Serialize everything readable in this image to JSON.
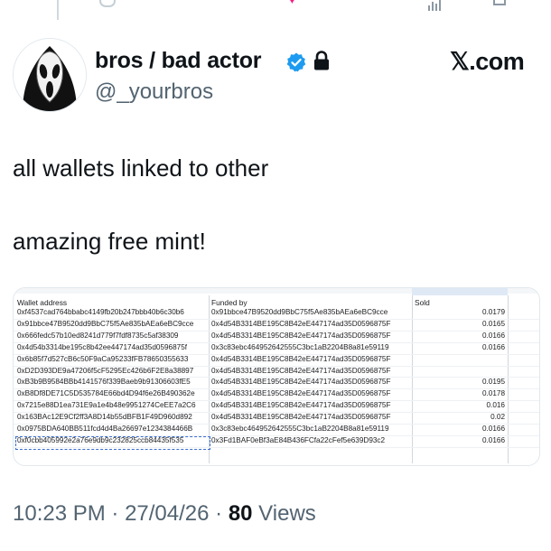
{
  "header": {
    "name": "bros / bad actor",
    "handle": "@_yourbros",
    "brand": "𝕏.com"
  },
  "icons": {
    "avatar": "ghostface-mask-icon",
    "verified": "verified-badge-icon",
    "lock": "lock-icon",
    "top_reply": "reply-icon",
    "top_like": "heart-icon",
    "top_stats": "stats-icon",
    "top_bookmark": "bookmark-icon"
  },
  "colors": {
    "verified": "#1d9bf0",
    "like": "#f91880",
    "muted": "#536471",
    "text": "#0f1419"
  },
  "tweet": {
    "line1": "all wallets linked to other",
    "line2": "amazing free mint!"
  },
  "spreadsheet": {
    "headers": {
      "wallet": "Wallet address",
      "funded": "Funded by",
      "sold": "Sold"
    },
    "rows": [
      {
        "wallet": "0xf4537cad764bbabc4149fb20b247bbb40b6c30b6",
        "funded": "0x91bbce47B9520dd9BbC75f5Ae835bAEa6eBC9cce",
        "sold": "0.0179"
      },
      {
        "wallet": "0x91bbce47B9520dd9BbC75f5Ae835bAEa6eBC9cce",
        "funded": "0x4d54B3314BE195C8B42eE447174ad35D0596875F",
        "sold": "0.0165"
      },
      {
        "wallet": "0x666fedc57b10ed8241d779f7fdf8735c5af38309",
        "funded": "0x4d54B3314BE195C8B42eE447174ad35D0596875F",
        "sold": "0.0166"
      },
      {
        "wallet": "0x4d54b3314be195c8b42ee447174ad35d0596875f",
        "funded": "0x3c83ebc464952642555C3bc1aB2204B8a81e59119",
        "sold": "0.0166"
      },
      {
        "wallet": "0x6b85f7d527cB6c50F9aCa95233fFB78650355633",
        "funded": "0x4d54B3314BE195C8B42eE447174ad35D0596875F",
        "sold": ""
      },
      {
        "wallet": "0xD2D393DE9a47206f5cF5295Ec426b6F2E8a38897",
        "funded": "0x4d54B3314BE195C8B42eE447174ad35D0596875F",
        "sold": ""
      },
      {
        "wallet": "0xB3b9B9584BBb4141576f339Baeb9b91306603fE5",
        "funded": "0x4d54B3314BE195C8B42eE447174ad35D0596875F",
        "sold": "0.0195"
      },
      {
        "wallet": "0xB8Df8DE71C5D535784E66bd4D94f6e26B490362e",
        "funded": "0x4d54B3314BE195C8B42eE447174ad35D0596875F",
        "sold": "0.0178"
      },
      {
        "wallet": "0x7215e88D1ea731E9a1e4b48e9951274CeEE7a2C6",
        "funded": "0x4d54B3314BE195C8B42eE447174ad35D0596875F",
        "sold": "0.016"
      },
      {
        "wallet": "0x163BAc12E9Cf2ff3A8D14b55dBFB1F49D960d892",
        "funded": "0x4d54B3314BE195C8B42eE447174ad35D0596875F",
        "sold": "0.02"
      },
      {
        "wallet": "0x0975BDA640BB511fcd4d4Ba26697e1234384466B",
        "funded": "0x3c83ebc464952642555C3bc1aB2204B8a81e59119",
        "sold": "0.0166"
      },
      {
        "wallet": "0xf0cbb405992e2a76e9db9c232825ccb84435f535",
        "funded": "0x3Fd1BAF0eBf3aE84B436FCfa22cFef5e639D93c2",
        "sold": "0.0166"
      }
    ]
  },
  "meta": {
    "time": "10:23 PM",
    "separator": " · ",
    "date": "27/04/26",
    "views_count": "80",
    "views_label": " Views"
  }
}
